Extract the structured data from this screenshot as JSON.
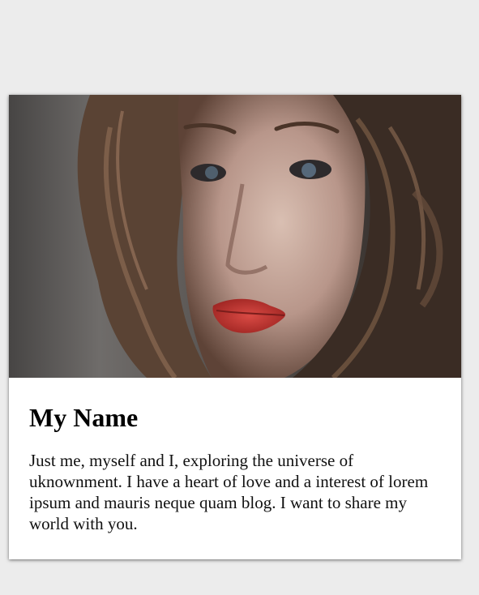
{
  "profile": {
    "name": "My Name",
    "bio": "Just me, myself and I, exploring the universe of uknownment. I have a heart of love and a interest of lorem ipsum and mauris neque quam blog. I want to share my world with you."
  },
  "colors": {
    "page_background": "#ececec",
    "card_background": "#ffffff",
    "lip_color": "#c0302c"
  },
  "photo": {
    "subject": "portrait-of-woman-with-curly-hair"
  }
}
